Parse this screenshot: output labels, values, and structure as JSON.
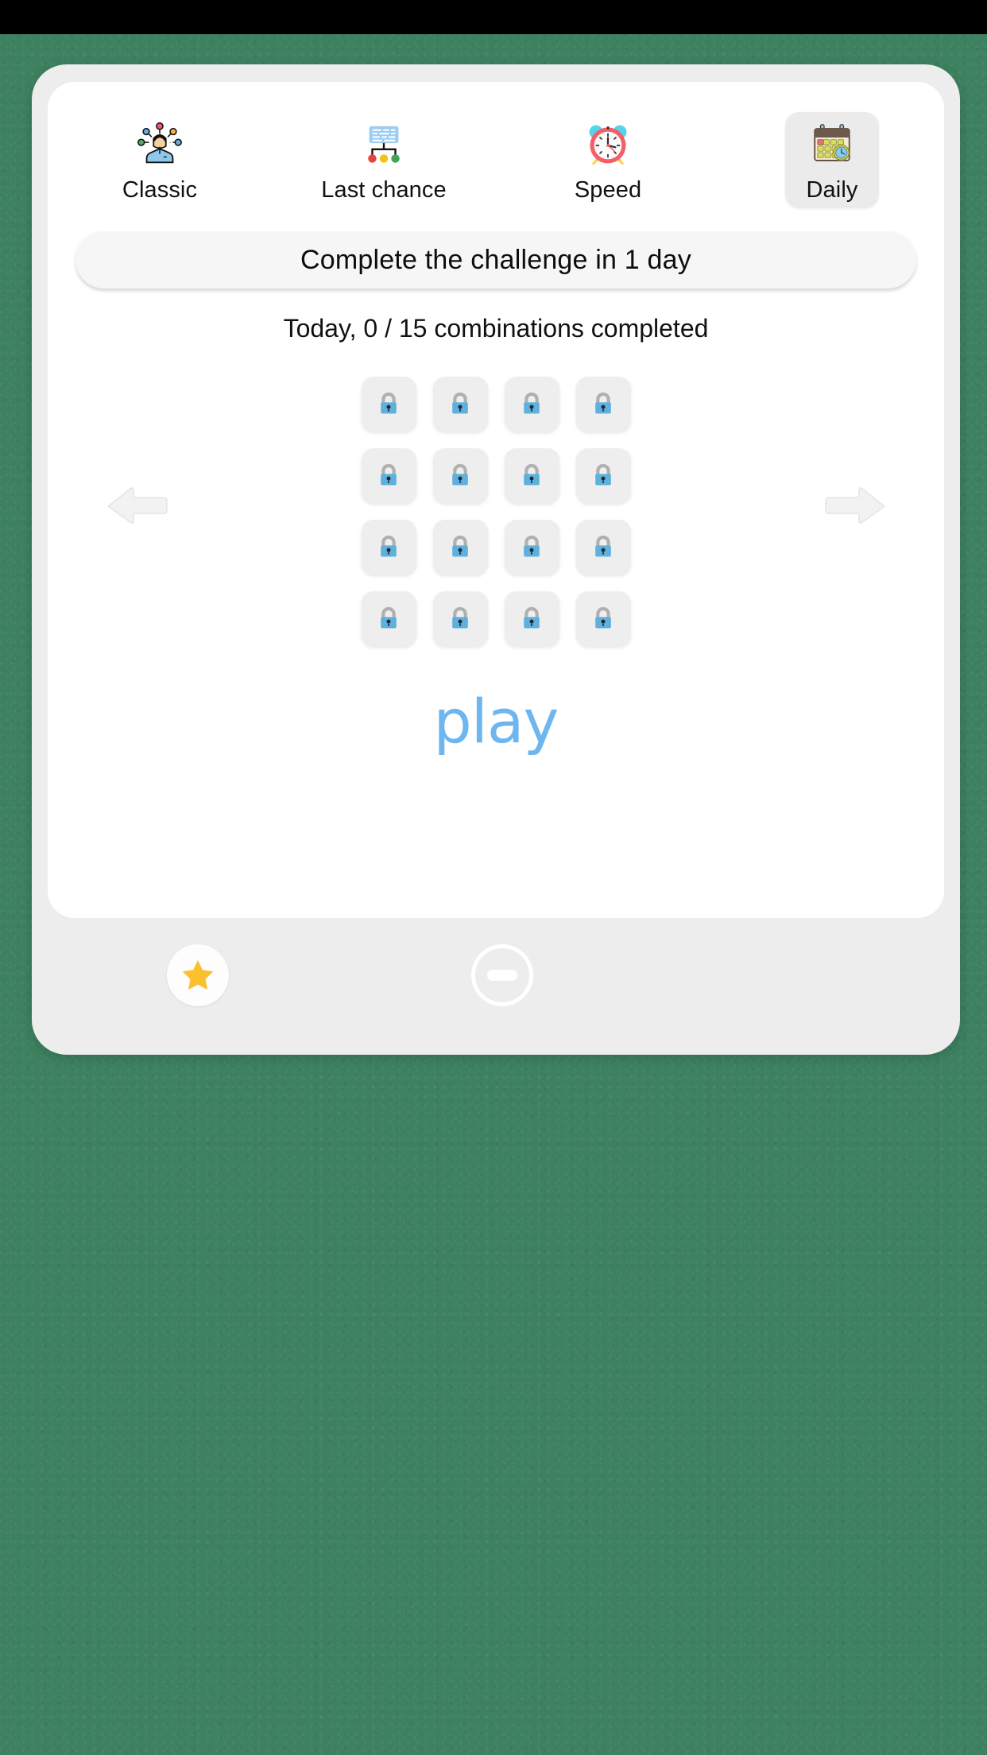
{
  "app": {
    "background_color": "#3d8160",
    "card_color": "#ededed",
    "panel_color": "#ffffff",
    "accent_color": "#6db6ef"
  },
  "tabs": [
    {
      "id": "classic",
      "label": "Classic",
      "icon": "brainstorm-person-icon",
      "selected": false
    },
    {
      "id": "last-chance",
      "label": "Last chance",
      "icon": "decision-tree-icon",
      "selected": false
    },
    {
      "id": "speed",
      "label": "Speed",
      "icon": "alarm-clock-icon",
      "selected": false
    },
    {
      "id": "daily",
      "label": "Daily",
      "icon": "calendar-clock-icon",
      "selected": true
    }
  ],
  "banner": {
    "text": "Complete the challenge in 1 day"
  },
  "progress": {
    "text": "Today, 0 / 15 combinations completed",
    "completed": 0,
    "total": 15
  },
  "grid": {
    "columns": 4,
    "rows": 4,
    "tile_icon": "lock-icon",
    "tile_color": "#eeeeee",
    "lock_body_color": "#5fb1dd",
    "lock_shackle_color": "#b3b3b3",
    "tiles": [
      {
        "index": 1,
        "state": "locked"
      },
      {
        "index": 2,
        "state": "locked"
      },
      {
        "index": 3,
        "state": "locked"
      },
      {
        "index": 4,
        "state": "locked"
      },
      {
        "index": 5,
        "state": "locked"
      },
      {
        "index": 6,
        "state": "locked"
      },
      {
        "index": 7,
        "state": "locked"
      },
      {
        "index": 8,
        "state": "locked"
      },
      {
        "index": 9,
        "state": "locked"
      },
      {
        "index": 10,
        "state": "locked"
      },
      {
        "index": 11,
        "state": "locked"
      },
      {
        "index": 12,
        "state": "locked"
      },
      {
        "index": 13,
        "state": "locked"
      },
      {
        "index": 14,
        "state": "locked"
      },
      {
        "index": 15,
        "state": "locked"
      },
      {
        "index": 16,
        "state": "locked"
      }
    ]
  },
  "nav": {
    "previous_icon": "arrow-left-icon",
    "next_icon": "arrow-right-icon"
  },
  "play": {
    "label": "play"
  },
  "footer": {
    "favorite_icon": "star-icon",
    "favorite_color": "#fbc02d",
    "remove_icon": "minus-circle-icon"
  }
}
